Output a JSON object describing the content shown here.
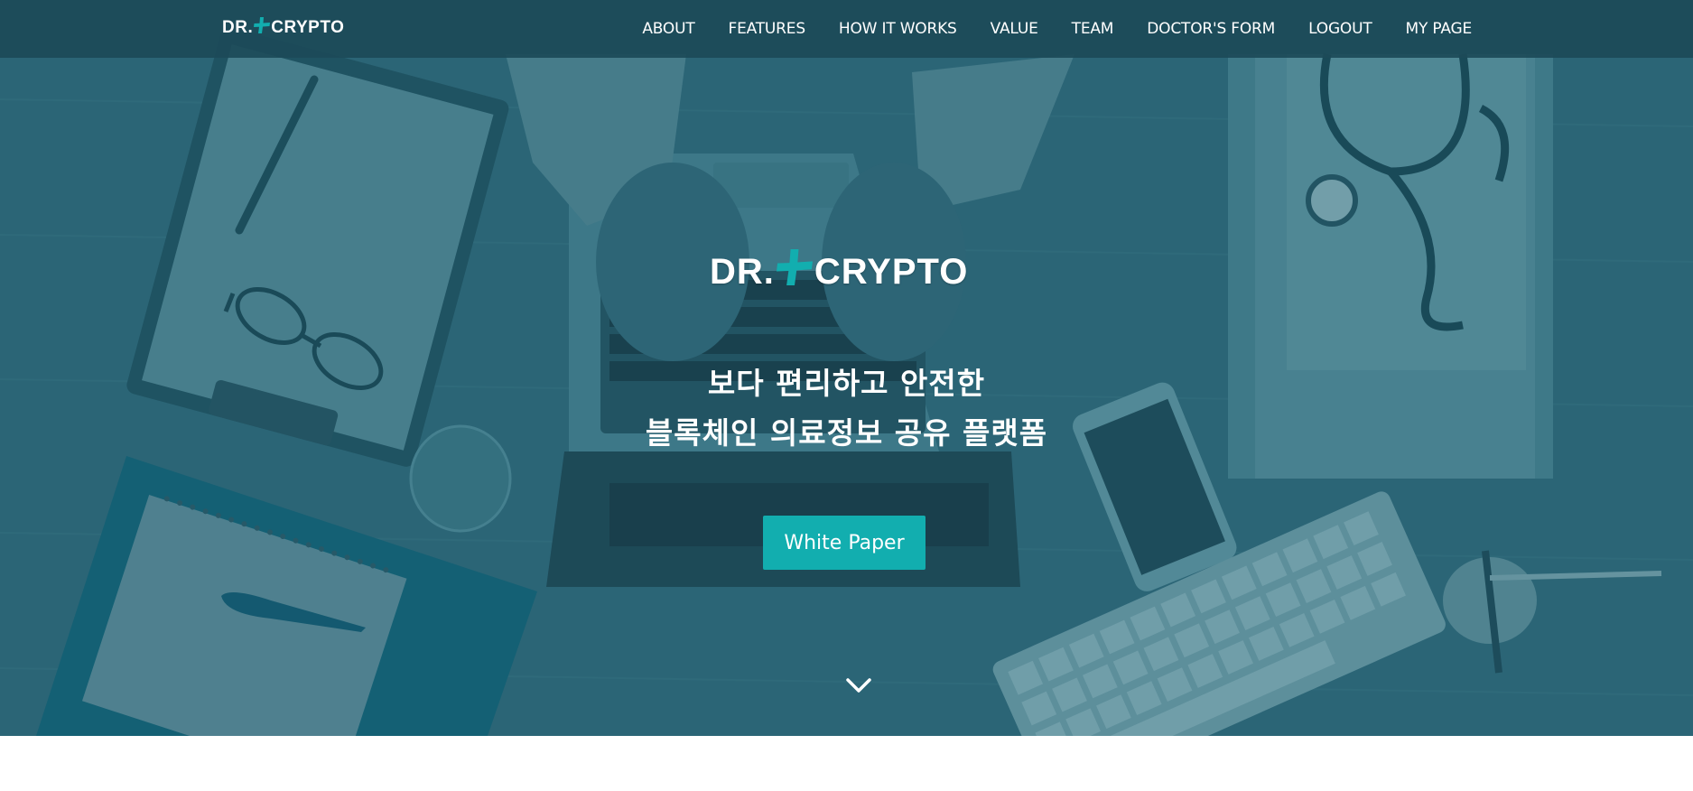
{
  "brand": {
    "logo_left": "DR.",
    "logo_right": "CRYPTO",
    "accent_color": "#12aeaf"
  },
  "nav": {
    "items": [
      {
        "label": "ABOUT"
      },
      {
        "label": "FEATURES"
      },
      {
        "label": "HOW IT WORKS"
      },
      {
        "label": "VALUE"
      },
      {
        "label": "TEAM"
      },
      {
        "label": "DOCTOR'S FORM"
      },
      {
        "label": "LOGOUT"
      },
      {
        "label": "MY PAGE"
      }
    ]
  },
  "hero": {
    "logo_left": "DR.",
    "logo_right": "CRYPTO",
    "title_line1": "보다 편리하고 안전한",
    "title_line2": "블록체인 의료정보 공유 플랫폼",
    "cta_label": "White Paper",
    "scroll_icon": "chevron-down-icon",
    "overlay_color": "#2f6876"
  }
}
